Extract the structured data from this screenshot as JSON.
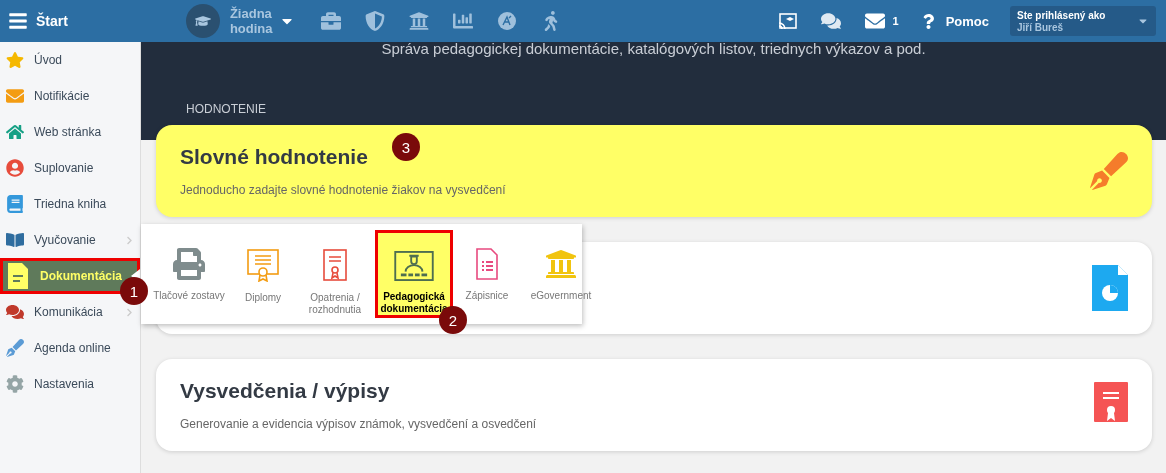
{
  "topbar": {
    "start_label": "Štart",
    "lesson": {
      "line1": "Žiadna",
      "line2": "hodina"
    },
    "mail_count": "1",
    "help_label": "Pomoc",
    "user": {
      "caption": "Ste prihlásený ako",
      "name": "Jiří Bureš"
    }
  },
  "sidebar": {
    "items": [
      {
        "label": "Úvod",
        "selected": false,
        "submenu": false
      },
      {
        "label": "Notifikácie",
        "selected": false,
        "submenu": false
      },
      {
        "label": "Web stránka",
        "selected": false,
        "submenu": false
      },
      {
        "label": "Suplovanie",
        "selected": false,
        "submenu": false
      },
      {
        "label": "Triedna kniha",
        "selected": false,
        "submenu": false
      },
      {
        "label": "Vyučovanie",
        "selected": false,
        "submenu": true
      },
      {
        "label": "Dokumentácia",
        "selected": true,
        "submenu": true,
        "highlighted": true,
        "marker": "1"
      },
      {
        "label": "Komunikácia",
        "selected": false,
        "submenu": true
      },
      {
        "label": "Agenda online",
        "selected": false,
        "submenu": false
      },
      {
        "label": "Nastavenia",
        "selected": false,
        "submenu": false
      }
    ]
  },
  "header": {
    "subtitle": "Správa pedagogickej dokumentácie, katalógových listov, triednych výkazov a pod.",
    "section": "HODNOTENIE"
  },
  "cards": [
    {
      "title": "Slovné hodnotenie",
      "description": "Jednoducho zadajte slovné hodnotenie žiakov na vysvedčení",
      "highlighted": true,
      "marker": "3"
    },
    {
      "highlighted": false
    },
    {
      "title": "Vysvedčenia / výpisy",
      "description": "Generovanie a evidencia výpisov známok, vysvedčení a osvedčení",
      "highlighted": false
    }
  ],
  "submenu": {
    "items": [
      {
        "label": "Tlačové zostavy",
        "selected": false
      },
      {
        "label": "Diplomy",
        "selected": false
      },
      {
        "label": "Opatrenia / rozhodnutia",
        "selected": false
      },
      {
        "label": "Pedagogická dokumentácia",
        "selected": true,
        "highlighted": true,
        "marker": "2"
      },
      {
        "label": "Zápisnice",
        "selected": false
      },
      {
        "label": "eGovernment",
        "selected": false
      }
    ]
  }
}
